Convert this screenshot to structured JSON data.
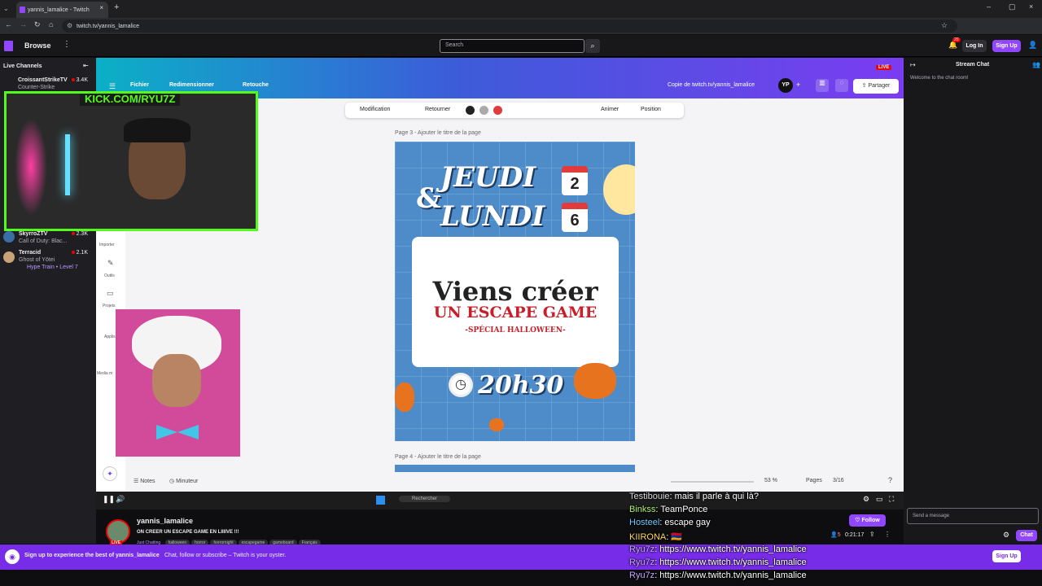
{
  "browser": {
    "tab_title": "yannis_lamalice - Twitch",
    "url": "twitch.tv/yannis_lamalice"
  },
  "twitch": {
    "browse": "Browse",
    "search_placeholder": "Search",
    "notif_count": "20",
    "login": "Log In",
    "signup": "Sign Up",
    "live_channels_title": "Live Channels",
    "channels": [
      {
        "name": "CroissantStrikeTV",
        "game": "Counter-Strike",
        "viewers": "3.4K"
      },
      {
        "name": "SkyrroZTV",
        "game": "Call of Duty: Blac...",
        "viewers": "2.3K"
      },
      {
        "name": "Terracid",
        "game": "Ghost of Yōtei",
        "viewers": "2.1K",
        "extra": "Hype Train • Level 7"
      }
    ]
  },
  "chat": {
    "title": "Stream Chat",
    "welcome": "Welcome to the chat room!",
    "send_placeholder": "Send a message",
    "chat_button": "Chat",
    "messages": [
      {
        "user": "Testibouie",
        "text": ": mais il parle à qui là?"
      },
      {
        "user": "Binkss",
        "text": ": TeamPonce"
      },
      {
        "user": "Hosteel",
        "text": ": escape gay"
      },
      {
        "user": "KIIRONA",
        "text": ": 🇦🇲"
      },
      {
        "user": "Ryu7z",
        "text": ": https://www.twitch.tv/yannis_lamalice"
      },
      {
        "user": "Ryu7z",
        "text": ": https://www.twitch.tv/yannis_lamalice"
      },
      {
        "user": "Ryu7z",
        "text": ": https://www.twitch.tv/yannis_lamalice"
      }
    ]
  },
  "stream": {
    "live": "LIVE",
    "kick_banner": "KICK.COM/RYU7Z",
    "streamer": "yannis_lamalice",
    "title": "ON CREER UN ESCAPE GAME EN LIIIIVE !!!",
    "category": "Just Chatting",
    "tags": [
      "halloween",
      "horror",
      "horrornight",
      "escapegame",
      "gameboard",
      "Français"
    ],
    "follow": "Follow",
    "viewers": "5",
    "uptime": "0:21:17"
  },
  "canva": {
    "menu": [
      "Fichier",
      "Redimensionner",
      "Retouche"
    ],
    "doc_title": "Copie de twitch.tv/yannis_lamalice",
    "avatar": "YP",
    "share": "Partager",
    "toolbar": {
      "modification": "Modification",
      "retourner": "Retourner",
      "animer": "Animer",
      "position": "Position"
    },
    "left_items": [
      "Importer",
      "Outils",
      "Projets",
      "Applis",
      "Media m"
    ],
    "page3_label": "Page 3 - Ajouter le titre de la page",
    "page4_label": "Page 4 - Ajouter le titre de la page",
    "notes": "Notes",
    "timer": "Minuteur",
    "zoom": "53 %",
    "pages_label": "Pages",
    "page_count": "3/16",
    "taskbar_search": "Rechercher"
  },
  "poster": {
    "line1": "JEUDI",
    "amp": "&",
    "line2": "LUNDI",
    "day1": "2",
    "day2": "6",
    "title": "Viens créer",
    "subtitle": "UN ESCAPE GAME",
    "special": "-SPÉCIAL HALLOWEEN-",
    "time": "20h30"
  },
  "bottom": {
    "cta": "Sign up to experience the best of yannis_lamalice",
    "sub": "Chat, follow or subscribe – Twitch is your oyster.",
    "signup": "Sign Up"
  },
  "colors": {
    "twitch_purple": "#9147ff",
    "kick_green": "#53fc18",
    "canva_accent": "#7b3cf2"
  }
}
